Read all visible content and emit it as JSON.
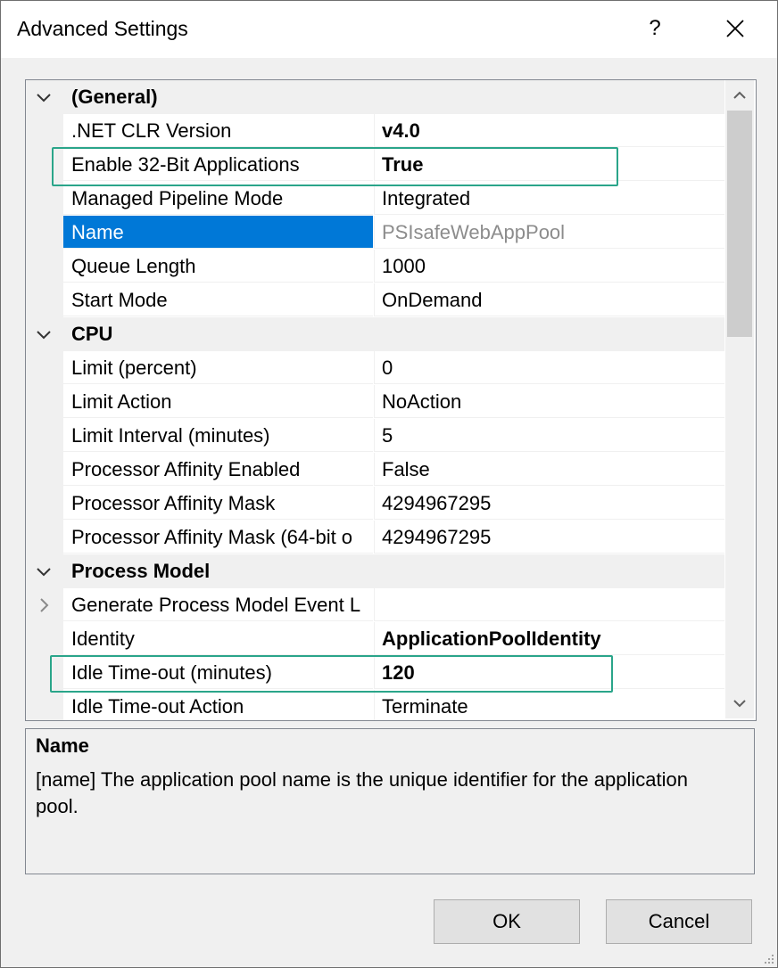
{
  "window": {
    "title": "Advanced Settings",
    "help_label": "?"
  },
  "grid": {
    "rows": [
      {
        "kind": "category",
        "label": "(General)",
        "expanded": true
      },
      {
        "kind": "property",
        "name": ".NET CLR Version",
        "value": "v4.0",
        "value_bold": true
      },
      {
        "kind": "property",
        "name": "Enable 32-Bit Applications",
        "value": "True",
        "value_bold": true,
        "highlighted": true
      },
      {
        "kind": "property",
        "name": "Managed Pipeline Mode",
        "value": "Integrated"
      },
      {
        "kind": "property",
        "name": "Name",
        "value": "PSIsafeWebAppPool",
        "selected": true
      },
      {
        "kind": "property",
        "name": "Queue Length",
        "value": "1000"
      },
      {
        "kind": "property",
        "name": "Start Mode",
        "value": "OnDemand"
      },
      {
        "kind": "category",
        "label": "CPU",
        "expanded": true
      },
      {
        "kind": "property",
        "name": "Limit (percent)",
        "value": "0"
      },
      {
        "kind": "property",
        "name": "Limit Action",
        "value": "NoAction"
      },
      {
        "kind": "property",
        "name": "Limit Interval (minutes)",
        "value": "5"
      },
      {
        "kind": "property",
        "name": "Processor Affinity Enabled",
        "value": "False"
      },
      {
        "kind": "property",
        "name": "Processor Affinity Mask",
        "value": "4294967295"
      },
      {
        "kind": "property",
        "name": "Processor Affinity Mask (64-bit o",
        "value": "4294967295"
      },
      {
        "kind": "category",
        "label": "Process Model",
        "expanded": true
      },
      {
        "kind": "property",
        "name": "Generate Process Model Event L",
        "value": "",
        "expandable": true
      },
      {
        "kind": "property",
        "name": "Identity",
        "value": "ApplicationPoolIdentity",
        "value_bold": true
      },
      {
        "kind": "property",
        "name": "Idle Time-out (minutes)",
        "value": "120",
        "value_bold": true,
        "highlighted": true
      },
      {
        "kind": "property",
        "name": "Idle Time-out Action",
        "value": "Terminate"
      }
    ]
  },
  "description": {
    "title": "Name",
    "text": "[name] The application pool name is the unique identifier for the application pool."
  },
  "buttons": {
    "ok": "OK",
    "cancel": "Cancel"
  },
  "colors": {
    "selection": "#0078d7",
    "highlight_border": "#2aa58a",
    "dialog_bg": "#f0f0f0"
  }
}
